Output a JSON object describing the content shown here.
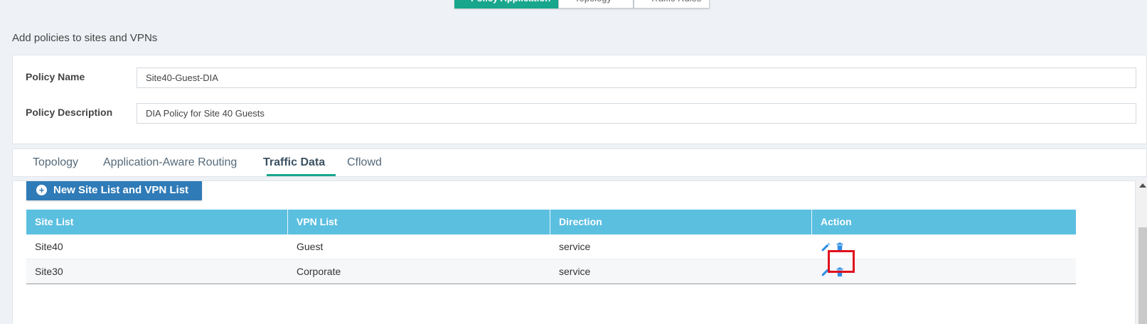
{
  "top_tabs": [
    {
      "label": "Policy Application"
    },
    {
      "label": "Topology"
    },
    {
      "label": "Traffic Rules"
    }
  ],
  "page_heading": "Add policies to sites and VPNs",
  "form": {
    "policy_name_label": "Policy Name",
    "policy_name_value": "Site40-Guest-DIA",
    "policy_description_label": "Policy Description",
    "policy_description_value": "DIA Policy for Site 40 Guests"
  },
  "tabs": [
    {
      "label": "Topology"
    },
    {
      "label": "Application-Aware Routing"
    },
    {
      "label": "Traffic Data",
      "active": true
    },
    {
      "label": "Cflowd"
    }
  ],
  "new_button_label": "New Site List and VPN List",
  "table": {
    "headers": [
      "Site List",
      "VPN List",
      "Direction",
      "Action"
    ],
    "rows": [
      {
        "site_list": "Site40",
        "vpn_list": "Guest",
        "direction": "service"
      },
      {
        "site_list": "Site30",
        "vpn_list": "Corporate",
        "direction": "service"
      }
    ]
  },
  "colors": {
    "accent": "#18a68d",
    "table_header": "#5bbfe0",
    "button": "#2f7bb8",
    "action_icon": "#2f8ee6",
    "highlight": "#e0101f"
  },
  "icons": [
    "edit-icon",
    "trash-icon",
    "plus-circle-icon",
    "scroll-up-arrow-icon"
  ]
}
